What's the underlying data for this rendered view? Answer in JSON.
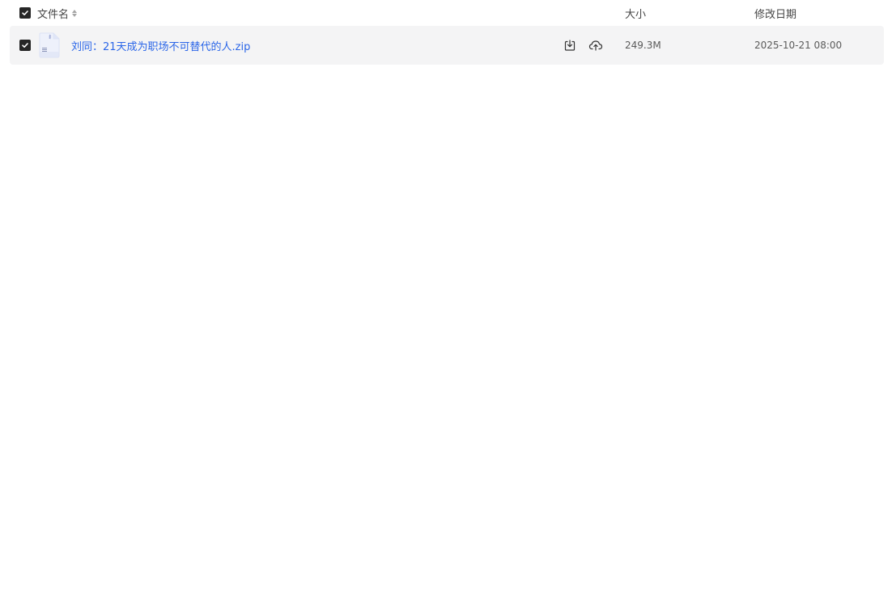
{
  "header": {
    "name_label": "文件名",
    "size_label": "大小",
    "date_label": "修改日期",
    "select_all_checked": true,
    "sort_icon": "sort-caret-icon"
  },
  "files": [
    {
      "name": "刘同：21天成为职场不可替代的人.zip",
      "size": "249.3M",
      "modified": "2025-10-21 08:00",
      "checked": true,
      "file_icon": "zip-file-icon",
      "actions": [
        "download-icon",
        "cloud-save-icon"
      ]
    }
  ],
  "colors": {
    "link": "#2b66e8",
    "row_selected_bg": "#f4f4f5",
    "checkbox": "#262626"
  }
}
